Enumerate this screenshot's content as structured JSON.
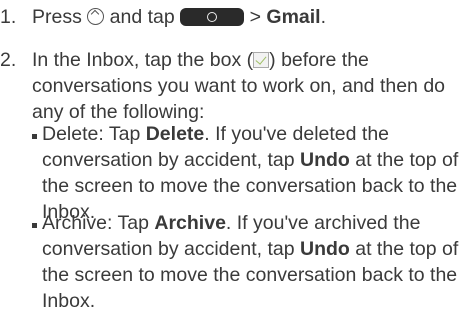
{
  "step1": {
    "number": "1.",
    "press": "Press ",
    "and_tap": " and tap ",
    "gt": " > ",
    "gmail": "Gmail",
    "end": "."
  },
  "step2": {
    "number": "2.",
    "line1_pre": "In the Inbox, tap the box (",
    "line1_post": ") before the",
    "line2": "conversations you want to work on, and then do",
    "line3": "any of the following:"
  },
  "bullets": [
    {
      "lead": "Delete: Tap ",
      "action": "Delete",
      "rest1": ". If you've deleted the",
      "line2_pre": "conversation by accident, tap ",
      "undo": "Undo",
      "line2_post": " at the top of",
      "line3": "the screen to move the conversation back to the",
      "line4": "Inbox."
    },
    {
      "lead": "Archive: Tap ",
      "action": "Archive",
      "rest1": ". If you've archived the",
      "line2_pre": "conversation by accident, tap ",
      "undo": "Undo",
      "line2_post": " at the top of",
      "line3": "the screen to move the conversation back to the",
      "line4": "Inbox."
    }
  ],
  "icons": {
    "home": "home-icon",
    "launcher": "launcher-button-icon",
    "checkbox": "checkbox-icon"
  }
}
